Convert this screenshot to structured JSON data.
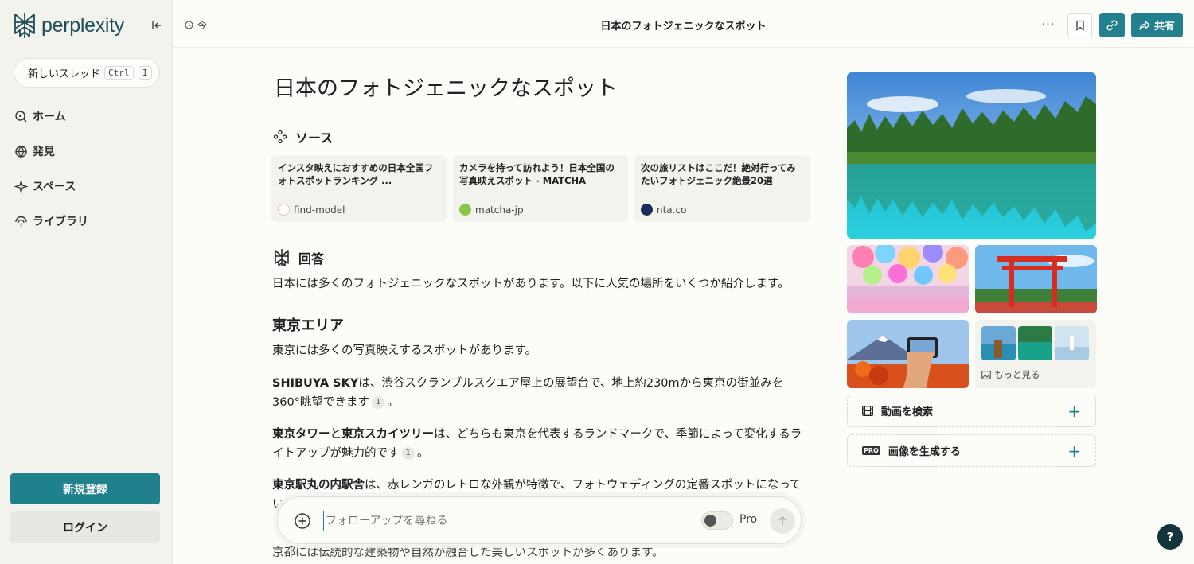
{
  "sidebar": {
    "logo_text": "perplexity",
    "new_thread_label": "新しいスレッド",
    "kbd_ctrl": "Ctrl",
    "kbd_i": "I",
    "nav": [
      {
        "label": "ホーム",
        "icon": "search-icon"
      },
      {
        "label": "発見",
        "icon": "globe-icon"
      },
      {
        "label": "スペース",
        "icon": "sparkle-icon"
      },
      {
        "label": "ライブラリ",
        "icon": "library-icon"
      }
    ],
    "signup_label": "新規登録",
    "login_label": "ログイン"
  },
  "header": {
    "time_label": "今",
    "title": "日本のフォトジェニックなスポット",
    "more_label": "···",
    "share_label": "共有"
  },
  "main": {
    "title": "日本のフォトジェニックなスポット",
    "sources_heading": "ソース",
    "sources": [
      {
        "title": "インスタ映えにおすすめの日本全国フォトスポットランキング ...",
        "site": "find-model"
      },
      {
        "title": "カメラを持って訪れよう！日本全国の写真映えスポット - MATCHA",
        "site": "matcha-jp"
      },
      {
        "title": "次の旅リストはここだ！絶対行ってみたいフォトジェニック絶景20選",
        "site": "nta.co"
      }
    ],
    "answer_heading": "回答",
    "intro": "日本には多くのフォトジェニックなスポットがあります。以下に人気の場所をいくつか紹介します。",
    "tokyo_heading": "東京エリア",
    "tokyo_intro": "東京には多くの写真映えするスポットがあります。",
    "sky_bold": "SHIBUYA SKY",
    "sky_text": "は、渋谷スクランブルスクエア屋上の展望台で、地上約230mから東京の街並みを360°眺望できます",
    "tower_bold1": "東京タワー",
    "tower_and": "と",
    "tower_bold2": "東京スカイツリー",
    "tower_text": "は、どちらも東京を代表するランドマークで、季節によって変化するライトアップが魅力的です",
    "station_bold": "東京駅丸の内駅舎",
    "station_text": "は、赤レンガのレトロな外観が特徴で、フォトウェディングの定番スポットになっています",
    "cite_num": "1",
    "period": "。",
    "kyoto_text": "京都には伝統的な建築物や自然が融合した美しいスポットが多くあります。"
  },
  "followup": {
    "placeholder": "フォローアップを尋ねる",
    "pro_label": "Pro",
    "pro_enabled": false
  },
  "media": {
    "more_label": "もっと見る",
    "video_label": "動画を検索",
    "image_label": "画像を生成する",
    "pro_badge": "PRO"
  },
  "help_label": "?",
  "colors": {
    "accent": "#20808d",
    "sidebar_bg": "#f3f3ee",
    "page_bg": "#fcfcf9",
    "text": "#202020"
  }
}
